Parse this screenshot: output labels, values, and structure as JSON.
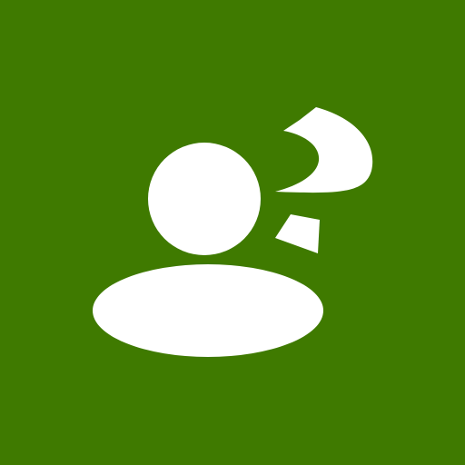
{
  "icon": {
    "name": "unknown-user-icon",
    "parts": [
      "person-head-icon",
      "person-body-icon",
      "question-mark-icon"
    ]
  },
  "colors": {
    "background": "#3f7a00",
    "foreground": "#ffffff"
  }
}
